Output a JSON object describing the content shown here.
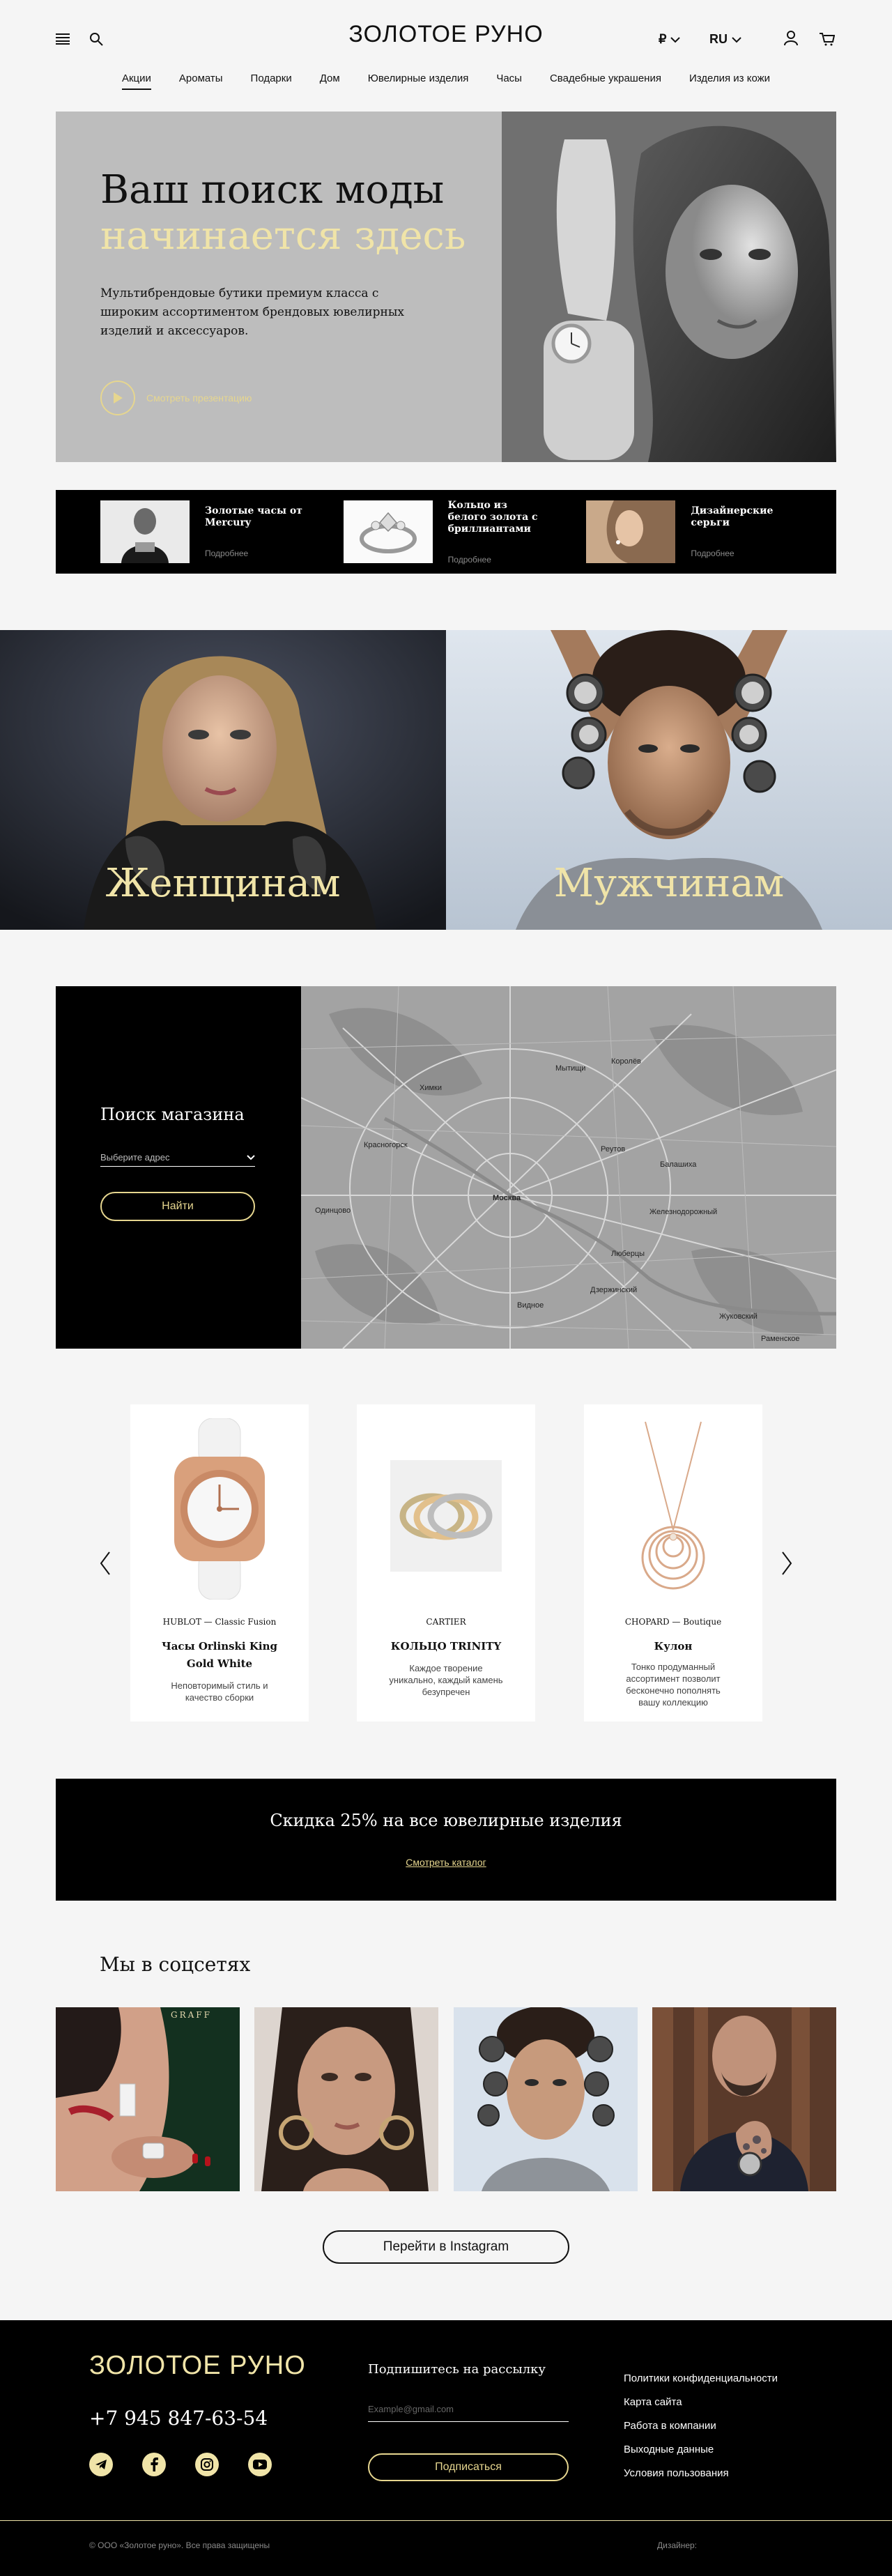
{
  "header": {
    "logo": "ЗОЛОТОЕ РУНО",
    "currency": "₽",
    "language": "RU",
    "nav": [
      "Акции",
      "Ароматы",
      "Подарки",
      "Дом",
      "Ювелирные изделия",
      "Часы",
      "Свадебные украшения",
      "Изделия из кожи"
    ],
    "active_nav": "Акции"
  },
  "hero": {
    "title_line1": "Ваш поиск моды",
    "title_line2": "начинается здесь",
    "description": "Мультибрендовые бутики премиум класса с широким ассортиментом брендовых ювелирных изделий и аксессуаров.",
    "play_label": "Смотреть презентацию"
  },
  "promo": [
    {
      "title": "Золотые часы от Mercury",
      "more": "Подробнее"
    },
    {
      "title": "Кольцо из белого золота с бриллиантами",
      "more": "Подробнее"
    },
    {
      "title": "Дизайнерские серьги",
      "more": "Подробнее"
    }
  ],
  "categories": {
    "women": "Женщинам",
    "men": "Мужчинам"
  },
  "store": {
    "title": "Поиск магазина",
    "select_placeholder": "Выберите адрес",
    "button": "Найти",
    "map_labels": [
      "Москва",
      "Химки",
      "Мытищи",
      "Королёв",
      "Балашиха",
      "Железнодорожный",
      "Люберцы",
      "Реутов",
      "Красногорск",
      "Одинцово",
      "Видное",
      "Дзержинский",
      "Жуковский",
      "Раменское"
    ]
  },
  "products": [
    {
      "brand": "HUBLOT — Classic Fusion",
      "name": "Часы Orlinski King Gold White",
      "desc": "Неповторимый стиль и качество сборки"
    },
    {
      "brand": "CARTIER",
      "name": "КОЛЬЦО TRINITY",
      "desc": "Каждое творение уникально, каждый камень безупречен"
    },
    {
      "brand": "CHOPARD — Boutique",
      "name": "Кулон",
      "desc": "Тонко продуманный ассортимент позволит бесконечно пополнять вашу коллекцию"
    }
  ],
  "sale": {
    "title": "Скидка 25% на все ювелирные изделия",
    "link": "Смотреть каталог"
  },
  "social": {
    "title": "Мы в соцсетях",
    "button": "Перейти в Instagram",
    "photo_caption": "GRAFF"
  },
  "footer": {
    "logo": "ЗОЛОТОЕ РУНО",
    "phone": "+7 945 847-63-54",
    "subscribe_title": "Подпишитесь на рассылку",
    "email_placeholder": "Example@gmail.com",
    "subscribe_button": "Подписаться",
    "links": [
      "Политики конфиденциальности",
      "Карта сайта",
      "Работа в компании",
      "Выходные данные",
      "Условия пользования"
    ],
    "copyright": "© ООО «Золотое руно». Все права защищены",
    "designer": "Дизайнер:"
  },
  "colors": {
    "accent": "#f0e4a8",
    "dark": "#000000",
    "background": "#f5f5f5"
  }
}
